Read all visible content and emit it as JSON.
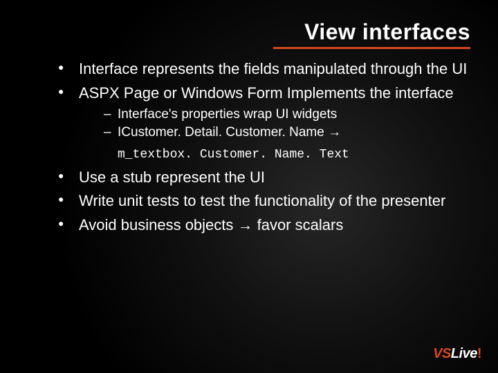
{
  "title": "View interfaces",
  "bullets": {
    "b1": "Interface represents the fields manipulated through the UI",
    "b2": "ASPX Page or Windows Form Implements the interface",
    "b2_sub1": "Interface's properties wrap UI widgets",
    "b2_sub2": "ICustomer. Detail. Customer. Name →",
    "b2_code": "m_textbox. Customer. Name. Text",
    "b3": "Use a stub represent the UI",
    "b4": "Write unit tests to test the functionality of the presenter",
    "b5": "Avoid business objects → favor scalars"
  },
  "logo": {
    "part1": "VS",
    "part2": "Live",
    "part3": "!"
  },
  "colors": {
    "accent": "#d8481d"
  }
}
